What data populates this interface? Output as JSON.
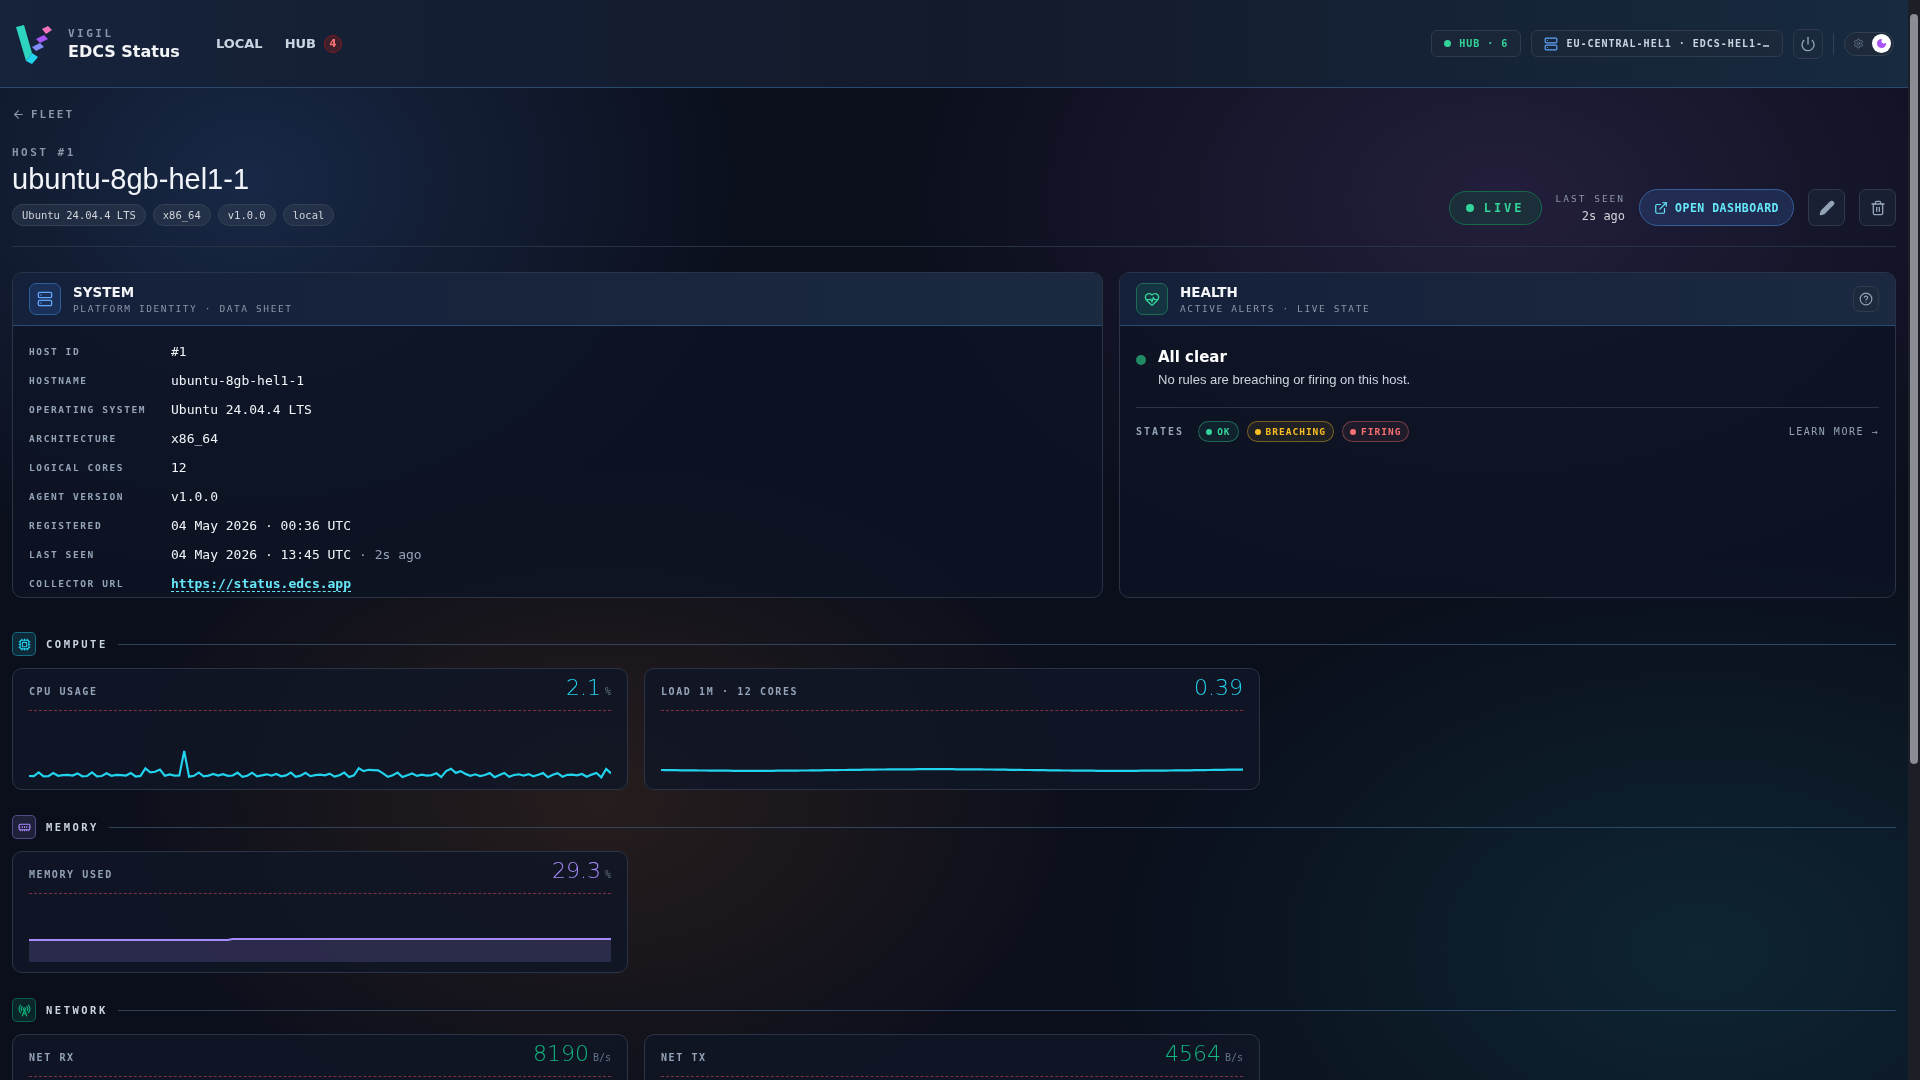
{
  "app": {
    "eyebrow": "VIGIL",
    "title": "EDCS Status"
  },
  "nav": [
    {
      "label": "LOCAL"
    },
    {
      "label": "HUB",
      "badge": "4"
    }
  ],
  "topbar": {
    "hub_status": "HUB · 6",
    "server": "EU-CENTRAL-HEL1 · EDCS-HEL1-…",
    "dark_mode": true
  },
  "back_link": "FLEET",
  "host": {
    "eyebrow": "HOST #1",
    "name": "ubuntu-8gb-hel1-1",
    "tags": [
      "Ubuntu 24.04.4 LTS",
      "x86_64",
      "v1.0.0",
      "local"
    ],
    "status": "LIVE",
    "last_seen_label": "LAST SEEN",
    "last_seen": "2s ago",
    "open_button": "OPEN DASHBOARD"
  },
  "system": {
    "title": "SYSTEM",
    "subtitle": "PLATFORM IDENTITY · DATA SHEET",
    "rows": [
      {
        "label": "HOST ID",
        "value": "#1",
        "kind": "text"
      },
      {
        "label": "HOSTNAME",
        "value": "ubuntu-8gb-hel1-1",
        "kind": "text"
      },
      {
        "label": "OPERATING SYSTEM",
        "value": "Ubuntu 24.04.4 LTS",
        "kind": "text"
      },
      {
        "label": "ARCHITECTURE",
        "value": "x86_64",
        "kind": "text"
      },
      {
        "label": "LOGICAL CORES",
        "value": "12",
        "kind": "text"
      },
      {
        "label": "AGENT VERSION",
        "value": "v1.0.0",
        "kind": "text"
      },
      {
        "label": "REGISTERED",
        "value": "04 May 2026 · 00:36 UTC",
        "kind": "text"
      },
      {
        "label": "LAST SEEN",
        "value": "04 May 2026 · 13:45 UTC",
        "note": "· 2s ago",
        "kind": "text"
      },
      {
        "label": "COLLECTOR URL",
        "value": "https://status.edcs.app",
        "kind": "link"
      }
    ]
  },
  "health": {
    "title": "HEALTH",
    "subtitle": "ACTIVE ALERTS · LIVE STATE",
    "status_title": "All clear",
    "status_text": "No rules are breaching or firing on this host.",
    "states_label": "STATES",
    "states": [
      {
        "label": "OK",
        "color": "#34d399"
      },
      {
        "label": "BREACHING",
        "color": "#fbbf24"
      },
      {
        "label": "FIRING",
        "color": "#f87171"
      }
    ],
    "learn_more": "LEARN MORE →"
  },
  "sections": [
    {
      "title": "COMPUTE",
      "kind": "compute",
      "metrics": [
        {
          "label": "CPU USAGE",
          "value": "2.1",
          "unit": "%",
          "color": "#22d3ee",
          "kind": "spiky"
        },
        {
          "label": "LOAD 1M · 12 CORES",
          "value": "0.39",
          "color": "#22d3ee",
          "kind": "flat"
        }
      ]
    },
    {
      "title": "MEMORY",
      "kind": "memory",
      "metrics": [
        {
          "label": "MEMORY USED",
          "value": "29.3",
          "unit": "%",
          "color": "#a78bfa",
          "kind": "area"
        }
      ]
    },
    {
      "title": "NETWORK",
      "kind": "network",
      "metrics": [
        {
          "label": "NET RX",
          "value": "8190",
          "unit": "B/s",
          "color": "#10b981"
        },
        {
          "label": "NET TX",
          "value": "4564",
          "unit": "B/s",
          "color": "#10b981"
        }
      ]
    }
  ]
}
